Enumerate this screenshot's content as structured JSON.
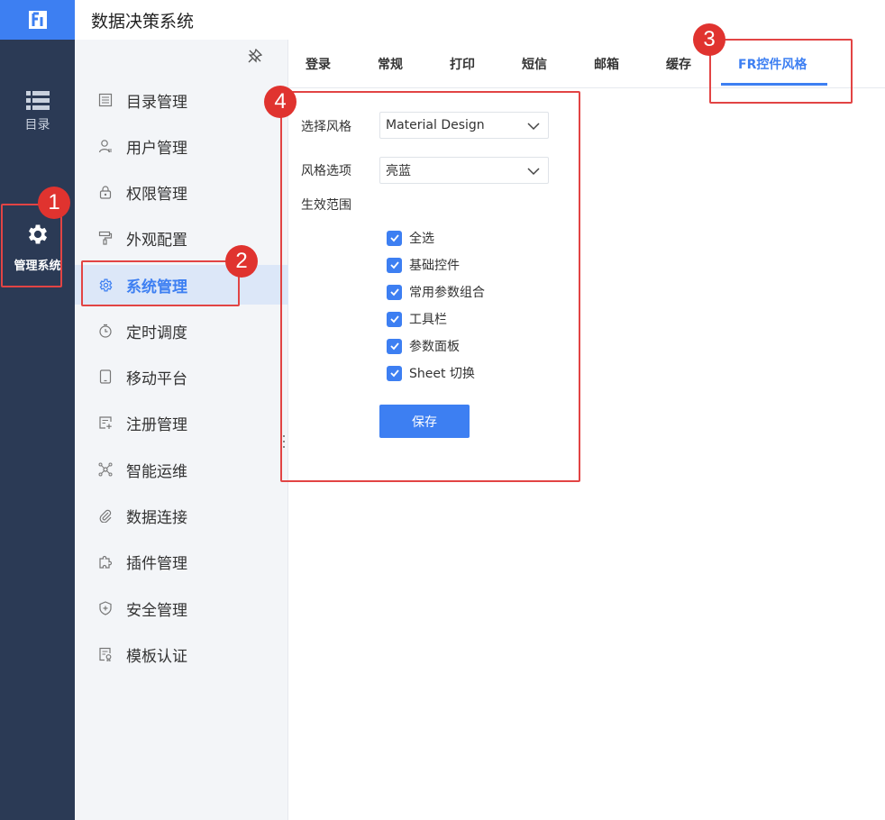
{
  "app": {
    "title": "数据决策系统"
  },
  "rail": {
    "catalog_label": "目录",
    "admin_label": "管理系统"
  },
  "subnav": {
    "items": [
      {
        "label": "目录管理",
        "icon": "list-icon"
      },
      {
        "label": "用户管理",
        "icon": "user-icon"
      },
      {
        "label": "权限管理",
        "icon": "lock-icon"
      },
      {
        "label": "外观配置",
        "icon": "paint-roller-icon"
      },
      {
        "label": "系统管理",
        "icon": "gear-icon"
      },
      {
        "label": "定时调度",
        "icon": "timer-icon"
      },
      {
        "label": "移动平台",
        "icon": "tablet-icon"
      },
      {
        "label": "注册管理",
        "icon": "register-icon"
      },
      {
        "label": "智能运维",
        "icon": "network-icon"
      },
      {
        "label": "数据连接",
        "icon": "paperclip-icon"
      },
      {
        "label": "插件管理",
        "icon": "puzzle-icon"
      },
      {
        "label": "安全管理",
        "icon": "shield-icon"
      },
      {
        "label": "模板认证",
        "icon": "certificate-icon"
      }
    ],
    "active_index": 4
  },
  "tabs": [
    {
      "label": "登录"
    },
    {
      "label": "常规"
    },
    {
      "label": "打印"
    },
    {
      "label": "短信"
    },
    {
      "label": "邮箱"
    },
    {
      "label": "缓存"
    },
    {
      "label": "FR控件风格"
    }
  ],
  "form": {
    "style_label": "选择风格",
    "style_value": "Material Design",
    "option_label": "风格选项",
    "option_value": "亮蓝",
    "scope_label": "生效范围",
    "checkboxes": [
      {
        "label": "全选",
        "checked": true
      },
      {
        "label": "基础控件",
        "checked": true
      },
      {
        "label": "常用参数组合",
        "checked": true
      },
      {
        "label": "工具栏",
        "checked": true
      },
      {
        "label": "参数面板",
        "checked": true
      },
      {
        "label": "Sheet 切换",
        "checked": true
      }
    ],
    "save_label": "保存"
  },
  "markers": [
    "1",
    "2",
    "3",
    "4"
  ],
  "colors": {
    "accent": "#3d7ff2",
    "rail": "#2b3a55",
    "annotation": "#e24444"
  }
}
